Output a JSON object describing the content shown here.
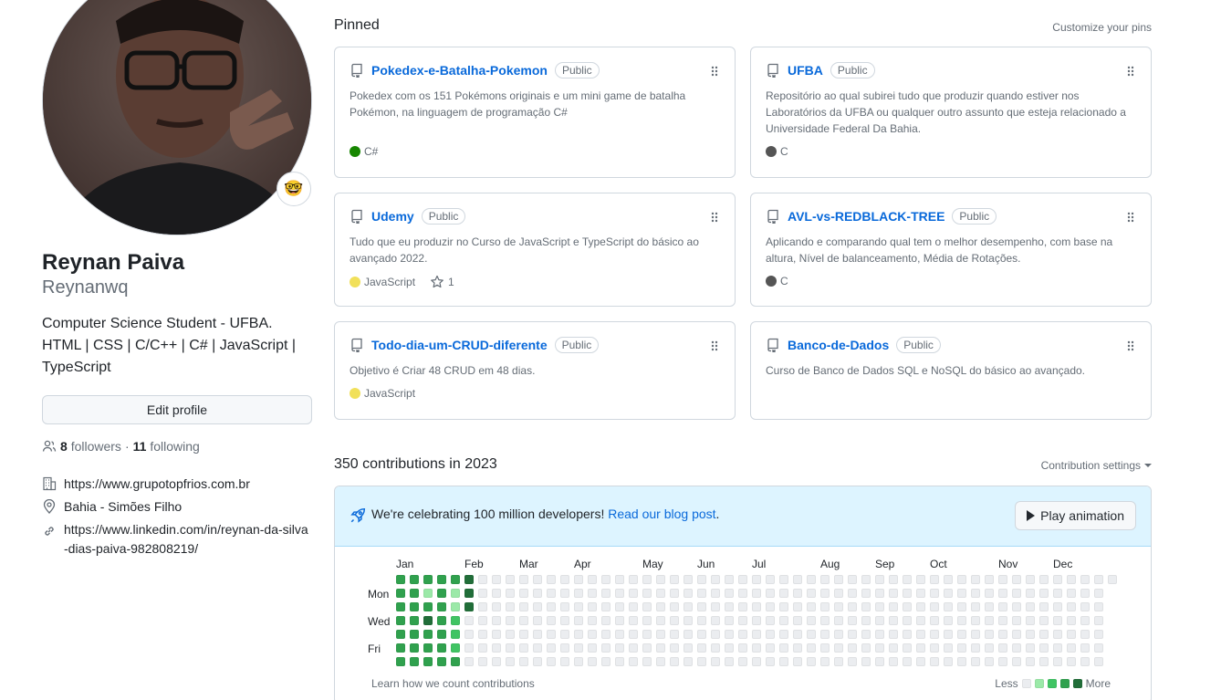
{
  "profile": {
    "full_name": "Reynan Paiva",
    "login": "Reynanwq",
    "status_emoji": "🤓",
    "bio": "Computer Science Student - UFBA. HTML | CSS | C/C++ | C# | JavaScript | TypeScript",
    "edit_label": "Edit profile",
    "followers_count": "8",
    "followers_label": "followers",
    "separator": "·",
    "following_count": "11",
    "following_label": "following",
    "website": "https://www.grupotopfrios.com.br",
    "location": "Bahia - Simões Filho",
    "linkedin": "https://www.linkedin.com/in/reynan-da-silva-dias-paiva-982808219/"
  },
  "pinned": {
    "title": "Pinned",
    "customize_label": "Customize your pins",
    "repos": [
      {
        "name": "Pokedex-e-Batalha-Pokemon",
        "visibility": "Public",
        "description": "Pokedex com os 151 Pokémons originais e um mini game de batalha Pokémon, na linguagem de programação C#",
        "language": "C#",
        "language_color": "#178600",
        "stars": ""
      },
      {
        "name": "UFBA",
        "visibility": "Public",
        "description": "Repositório ao qual subirei tudo que produzir quando estiver nos Laboratórios da UFBA ou qualquer outro assunto que esteja relacionado a Universidade Federal Da Bahia.",
        "language": "C",
        "language_color": "#555555",
        "stars": ""
      },
      {
        "name": "Udemy",
        "visibility": "Public",
        "description": "Tudo que eu produzir no Curso de JavaScript e TypeScript do básico ao avançado 2022.",
        "language": "JavaScript",
        "language_color": "#f1e05a",
        "stars": "1"
      },
      {
        "name": "AVL-vs-REDBLACK-TREE",
        "visibility": "Public",
        "description": "Aplicando e comparando qual tem o melhor desempenho, com base na altura, Nível de balanceamento, Média de Rotações.",
        "language": "C",
        "language_color": "#555555",
        "stars": ""
      },
      {
        "name": "Todo-dia-um-CRUD-diferente",
        "visibility": "Public",
        "description": "Objetivo é Criar 48 CRUD em 48 dias.",
        "language": "JavaScript",
        "language_color": "#f1e05a",
        "stars": ""
      },
      {
        "name": "Banco-de-Dados",
        "visibility": "Public",
        "description": "Curso de Banco de Dados SQL e NoSQL do básico ao avançado.",
        "language": "",
        "language_color": "",
        "stars": ""
      }
    ]
  },
  "contributions": {
    "title": "350 contributions in 2023",
    "settings_label": "Contribution settings",
    "banner_text": "We're celebrating 100 million developers!",
    "banner_link": "Read our blog post",
    "banner_period": ".",
    "play_label": "Play animation",
    "months": [
      "Jan",
      "Feb",
      "Mar",
      "Apr",
      "May",
      "Jun",
      "Jul",
      "Aug",
      "Sep",
      "Oct",
      "Nov",
      "Dec"
    ],
    "weekdays": [
      "Mon",
      "Wed",
      "Fri"
    ],
    "learn_label": "Learn how we count contributions",
    "less_label": "Less",
    "more_label": "More",
    "level_colors": [
      "#ebedf0",
      "#9be9a8",
      "#40c463",
      "#30a14e",
      "#216e39"
    ],
    "levels_by_week": [
      [
        3,
        3,
        3,
        3,
        3,
        3,
        3
      ],
      [
        3,
        3,
        3,
        3,
        3,
        3,
        3
      ],
      [
        3,
        1,
        3,
        4,
        3,
        3,
        3
      ],
      [
        3,
        3,
        3,
        3,
        3,
        3,
        3
      ],
      [
        3,
        1,
        1,
        2,
        2,
        2,
        3
      ],
      [
        4,
        4,
        4,
        0,
        0,
        0,
        0
      ]
    ]
  }
}
